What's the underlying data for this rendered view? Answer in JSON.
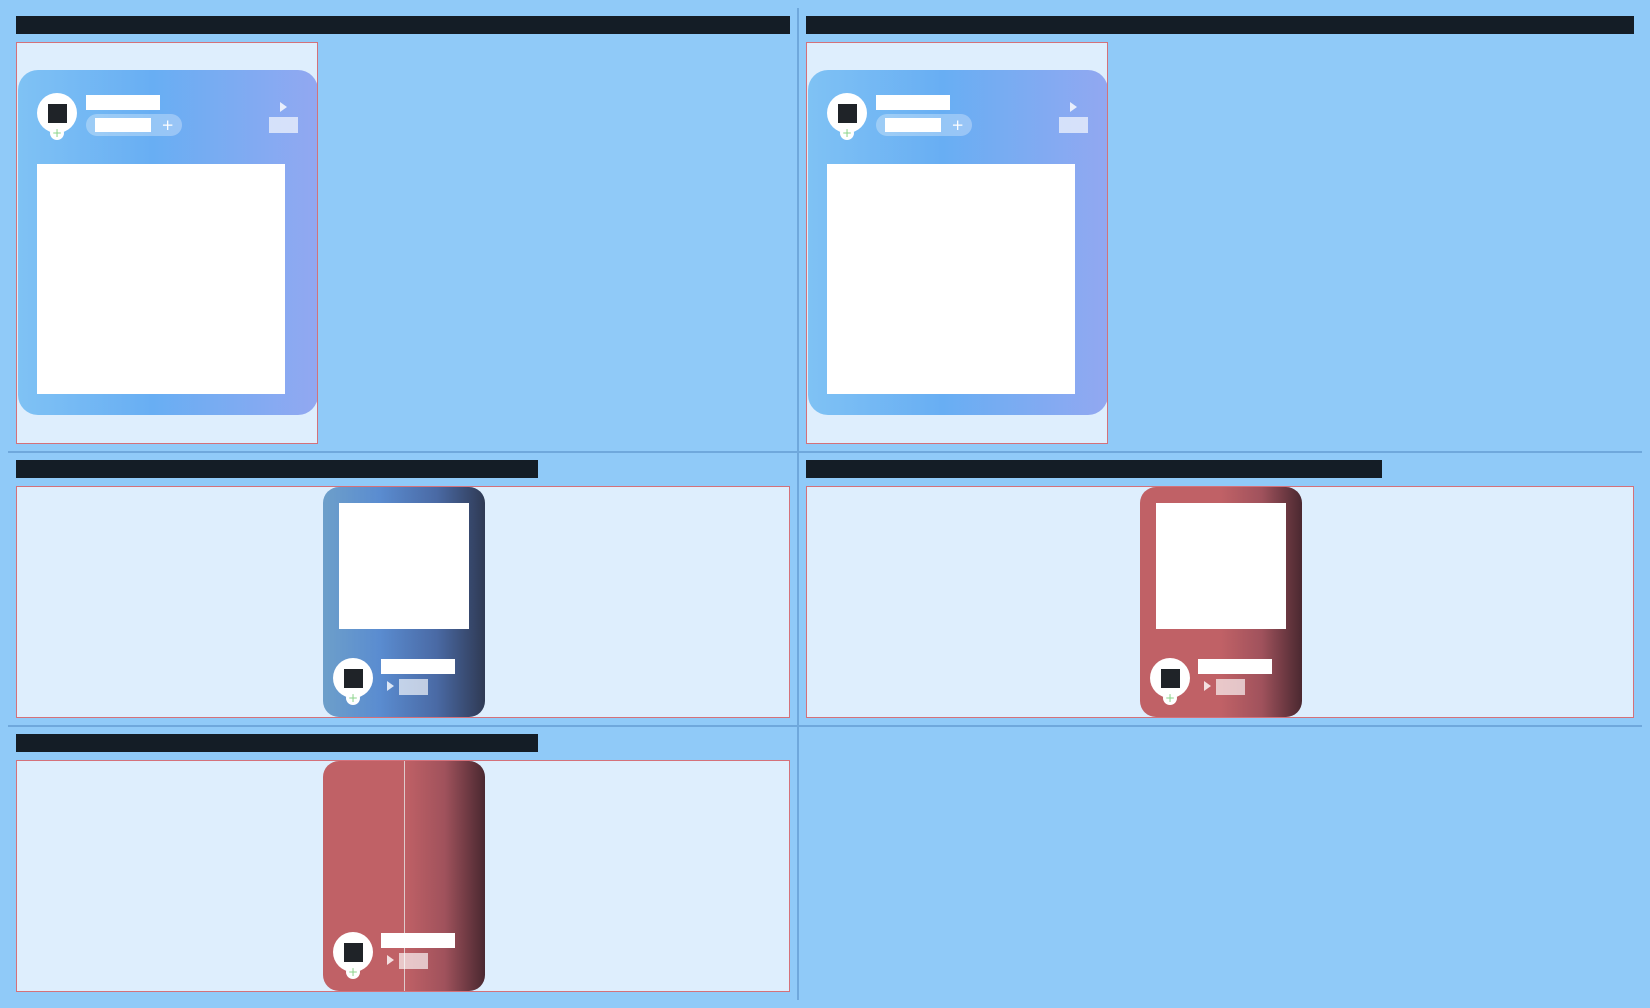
{
  "panels": [
    {
      "id": "desktop-a"
    },
    {
      "id": "desktop-b"
    },
    {
      "id": "mobile-blue"
    },
    {
      "id": "mobile-red"
    },
    {
      "id": "mobile-red-split"
    }
  ],
  "colors": {
    "page_background": "#90caf8",
    "frame_background": "#deeefd",
    "frame_border": "#d4717a",
    "title_bar": "#141d26",
    "avatar_square": "#1f2328",
    "plus_badge": "#8bd48b",
    "blue_card_start": "#6d9fca",
    "blue_card_end": "#2f3a54",
    "red_card_start": "#c06166",
    "red_card_end": "#4a2830"
  },
  "icons": {
    "add_badge": "plus-icon",
    "play": "play-icon",
    "pill_add": "plus-icon"
  },
  "glyphs": {
    "plus": "+"
  }
}
